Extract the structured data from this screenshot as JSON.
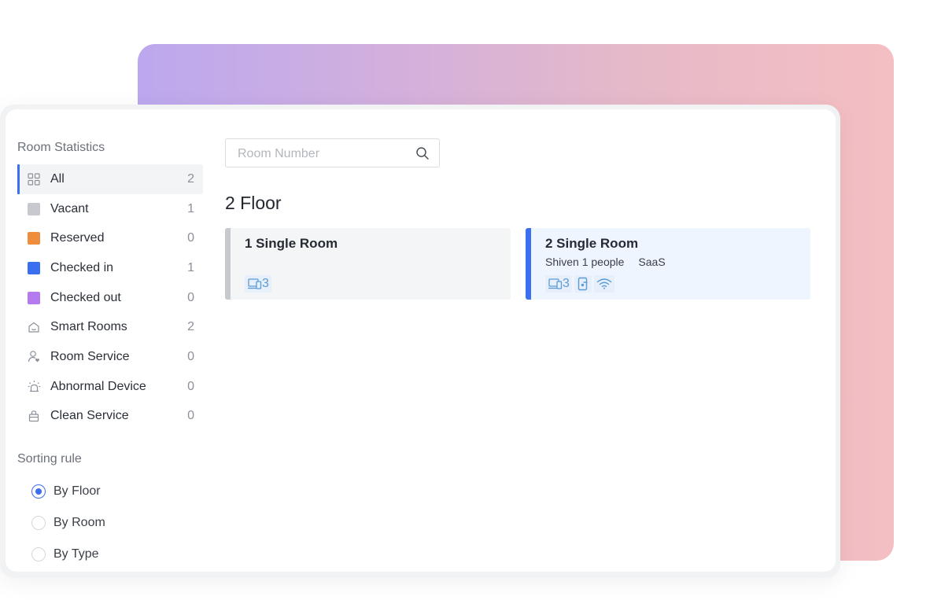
{
  "sidebar": {
    "stats_title": "Room Statistics",
    "items": [
      {
        "label": "All",
        "count": "2",
        "icon": "grid-icon"
      },
      {
        "label": "Vacant",
        "count": "1",
        "icon": "vacant-swatch",
        "color": "#c6c9ce"
      },
      {
        "label": "Reserved",
        "count": "0",
        "icon": "reserved-swatch",
        "color": "#ef8d3c"
      },
      {
        "label": "Checked in",
        "count": "1",
        "icon": "checked-in-swatch",
        "color": "#3a6ff0"
      },
      {
        "label": "Checked out",
        "count": "0",
        "icon": "checked-out-swatch",
        "color": "#b57af0"
      },
      {
        "label": "Smart Rooms",
        "count": "2",
        "icon": "smart-home-icon"
      },
      {
        "label": "Room Service",
        "count": "0",
        "icon": "user-service-icon"
      },
      {
        "label": "Abnormal Device",
        "count": "0",
        "icon": "alarm-light-icon"
      },
      {
        "label": "Clean Service",
        "count": "0",
        "icon": "cleaning-bag-icon"
      }
    ],
    "sorting_title": "Sorting rule",
    "sorting_options": [
      {
        "label": "By Floor",
        "checked": true
      },
      {
        "label": "By Room",
        "checked": false
      },
      {
        "label": "By Type",
        "checked": false
      }
    ]
  },
  "search": {
    "placeholder": "Room Number",
    "value": ""
  },
  "floor": {
    "title": "2 Floor"
  },
  "rooms": [
    {
      "name": "1 Single Room",
      "guest": "",
      "source": "",
      "device_count": "3",
      "status_color": "#c6c9ce"
    },
    {
      "name": "2 Single Room",
      "guest": "Shiven 1 people",
      "source": "SaaS",
      "device_count": "3",
      "status_color": "#3a6ff0"
    }
  ],
  "colors": {
    "accent": "#3c6ef0",
    "icon_blue": "#5b9bd6",
    "badge_bg": "#e6effa"
  }
}
